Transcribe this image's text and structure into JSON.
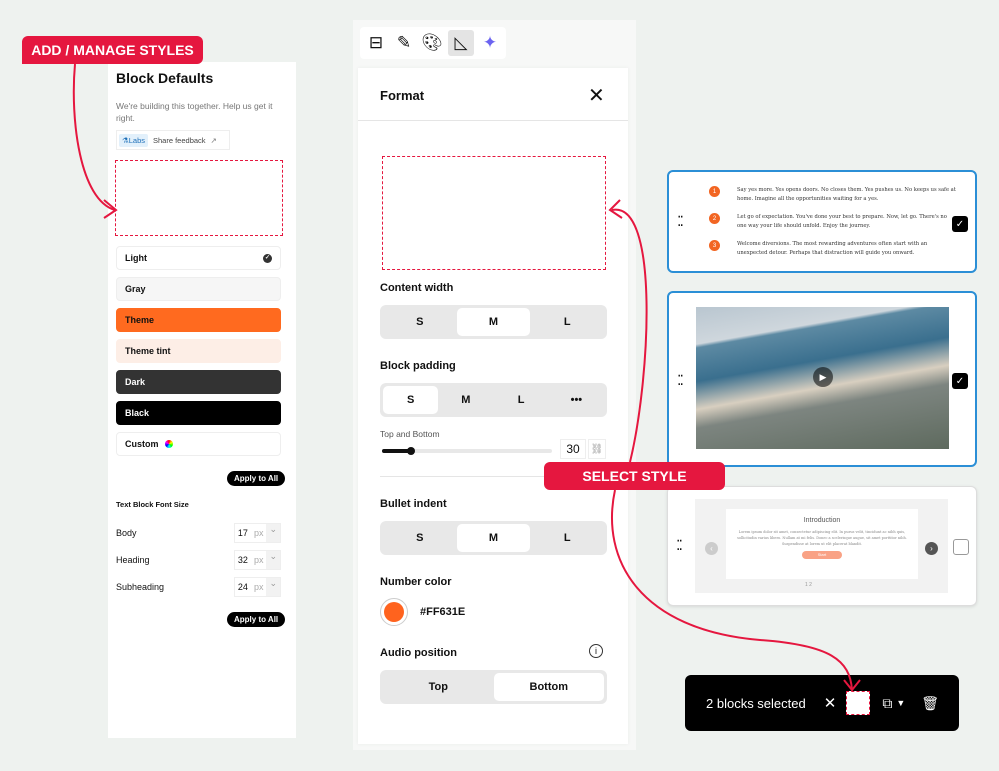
{
  "callouts": {
    "add_manage": "ADD / MANAGE STYLES",
    "select_style": "SELECT STYLE"
  },
  "block_defaults": {
    "title": "Block Defaults",
    "subtitle": "We're building this together. Help us get it right.",
    "labs": "Labs",
    "share_feedback": "Share feedback",
    "styles": [
      {
        "label": "Light",
        "selected": true
      },
      {
        "label": "Gray"
      },
      {
        "label": "Theme"
      },
      {
        "label": "Theme tint"
      },
      {
        "label": "Dark"
      },
      {
        "label": "Black"
      },
      {
        "label": "Custom"
      }
    ],
    "apply_all": "Apply to All",
    "font_size_title": "Text Block Font Size",
    "font_sizes": [
      {
        "label": "Body",
        "value": "17",
        "unit": "px"
      },
      {
        "label": "Heading",
        "value": "32",
        "unit": "px"
      },
      {
        "label": "Subheading",
        "value": "24",
        "unit": "px"
      }
    ]
  },
  "format": {
    "title": "Format",
    "content_width": {
      "label": "Content width",
      "options": [
        "S",
        "M",
        "L"
      ],
      "selected": "M"
    },
    "block_padding": {
      "label": "Block padding",
      "options": [
        "S",
        "M",
        "L",
        "•••"
      ],
      "selected": "S"
    },
    "top_bottom": {
      "label": "Top and Bottom",
      "value": "30",
      "fraction": 0.17
    },
    "bullet_indent": {
      "label": "Bullet indent",
      "options": [
        "S",
        "M",
        "L"
      ],
      "selected": "M"
    },
    "number_color": {
      "label": "Number color",
      "value": "#FF631E"
    },
    "audio_position": {
      "label": "Audio position",
      "options": [
        "Top",
        "Bottom"
      ],
      "selected": "Bottom"
    }
  },
  "cards": {
    "list": [
      "Say yes more. Yes opens doors. No closes them. Yes pushes us. No keeps us safe at home. Imagine all the opportunities waiting for a yes.",
      "Let go of expectation. You've done your best to prepare. Now, let go. There's no one way your life should unfold. Enjoy the journey.",
      "Welcome diversions. The most rewarding adventures often start with an unexpected detour. Perhaps that distraction will guide you onward."
    ],
    "carousel_title": "Introduction",
    "carousel_text": "Lorem ipsum dolor sit amet, consectetur adipiscing elit. In purus velit, tincidunt ac nibh quis, sollicitudin varius libero. Nullam at mi felis. Donec a scelerisque augue, sit amet porttitor nibh. Suspendisse at lorem ut elit placerat blandit.",
    "carousel_button": "Start",
    "carousel_pages": "1  2"
  },
  "selection_bar": {
    "text": "2 blocks selected"
  },
  "colors": {
    "accent": "#e5173f",
    "theme": "#ff6a1f",
    "tint": "#fdeee6",
    "select_blue": "#2b8fd6"
  }
}
